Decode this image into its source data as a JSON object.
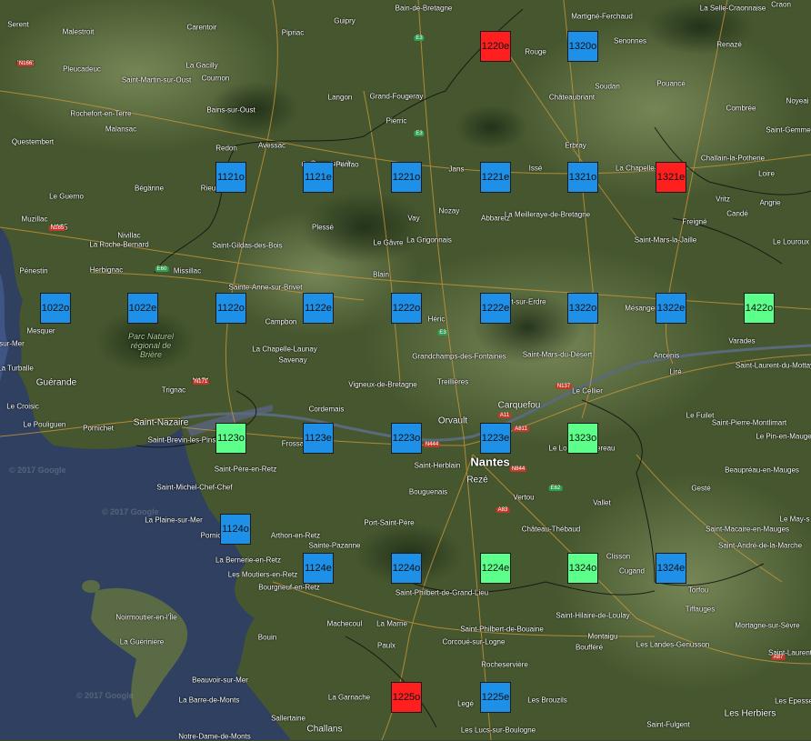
{
  "colors": {
    "blue": "#1e90e8",
    "red": "#ff1f1f",
    "green": "#5cff8a"
  },
  "markers": [
    {
      "label": "1220e",
      "color": "red"
    },
    {
      "label": "1320o",
      "color": "blue"
    },
    {
      "label": "1121o",
      "color": "blue"
    },
    {
      "label": "1121e",
      "color": "blue"
    },
    {
      "label": "1221o",
      "color": "blue"
    },
    {
      "label": "1221e",
      "color": "blue"
    },
    {
      "label": "1321o",
      "color": "blue"
    },
    {
      "label": "1321e",
      "color": "red"
    },
    {
      "label": "1022o",
      "color": "blue"
    },
    {
      "label": "1022e",
      "color": "blue"
    },
    {
      "label": "1122o",
      "color": "blue"
    },
    {
      "label": "1122e",
      "color": "blue"
    },
    {
      "label": "1222o",
      "color": "blue"
    },
    {
      "label": "1222e",
      "color": "blue"
    },
    {
      "label": "1322o",
      "color": "blue"
    },
    {
      "label": "1322e",
      "color": "blue"
    },
    {
      "label": "1422o",
      "color": "green"
    },
    {
      "label": "1123o",
      "color": "green"
    },
    {
      "label": "1123e",
      "color": "blue"
    },
    {
      "label": "1223o",
      "color": "blue"
    },
    {
      "label": "1223e",
      "color": "blue"
    },
    {
      "label": "1323o",
      "color": "green"
    },
    {
      "label": "1124o",
      "color": "blue"
    },
    {
      "label": "1124e",
      "color": "blue"
    },
    {
      "label": "1224o",
      "color": "blue"
    },
    {
      "label": "1224e",
      "color": "green"
    },
    {
      "label": "1324o",
      "color": "green"
    },
    {
      "label": "1324e",
      "color": "blue"
    },
    {
      "label": "1225o",
      "color": "red"
    },
    {
      "label": "1225e",
      "color": "blue"
    }
  ],
  "places": [
    "Serent",
    "Malestroit",
    "Carentoir",
    "Pipriac",
    "Guipry",
    "Bain-de-Bretagne",
    "Martigné-Ferchaud",
    "La Selle-Craonnaise",
    "Craon",
    "N166",
    "Pleucadeuc",
    "La Gacilly",
    "Saint-Martin-sur-Oust",
    "Cournon",
    "Rouge",
    "Senonnes",
    "Renazé",
    "Langon",
    "Grand-Fougeray",
    "Soudan",
    "Pouancé",
    "Noyeai",
    "Rochefort-en-Terre",
    "Malansac",
    "Bains-sur-Oust",
    "Pierric",
    "Châteaubriant",
    "Combrée",
    "Questembert",
    "Redon",
    "Avessac",
    "Conquereuil",
    "Erbray",
    "Saint-Gemme",
    "Challain-la-Potherie",
    "Loire",
    "Bégänne",
    "Rieux",
    "Guémené-Penfao",
    "Jans",
    "Issé",
    "La Chapelle-Glain",
    "Vritz",
    "Angrie",
    "Le Guerno",
    "Vay",
    "Nozay",
    "Abbaretz",
    "La Meilleraye-de-Bretagne",
    "Candé",
    "Muzillac",
    "N165",
    "Plessé",
    "Le Gâvre",
    "La Grigonnais",
    "Freigné",
    "Nivillac",
    "La Roche-Bernard",
    "Saint-Gildas-des-Bois",
    "Saint-Mars-la-Jaille",
    "Le Louroux",
    "Pénestin",
    "Missillac",
    "Sainte-Anne-sur-Brivet",
    "Blain",
    "Herbignac",
    "Campbon",
    "Héric",
    "Nort-sur-Erdre",
    "Mésanger",
    "Mesquer",
    "Varades",
    "sur-Mer",
    "Parc Naturel régional de Brière",
    "La Chapelle-Launay",
    "Savenay",
    "Grandchamps-des-Fontaines",
    "Saint-Mars-du-Désert",
    "Ancenis",
    "La Turballe",
    "Saint-Laurent-du-Mottay",
    "Guérande",
    "N171",
    "Liré",
    "Trignac",
    "Vigneux-de-Bretagne",
    "Treillières",
    "Le Cellier",
    "Le Croisic",
    "Cordemais",
    "Carquefou",
    "Le Fuilet",
    "Le Pouliguen",
    "Pornichet",
    "Saint-Nazaire",
    "Orvault",
    "Saint-Pierre-Montlimart",
    "Saint-Brevin-les-Pins",
    "Frossay",
    "Le Loroux-Bottereau",
    "Le Pin-en-Mauges",
    "Saint-Herblain",
    "Nantes",
    "Rezé",
    "Bouguenais",
    "Saint-Père-en-Retz",
    "Beaupréau-en-Mauges",
    "Saint-Michel-Chef-Chef",
    "Vertou",
    "Gesté",
    "Vallet",
    "La Plaine-sur-Mer",
    "Port-Saint-Père",
    "Château-Thébaud",
    "Le May-s",
    "Pornic",
    "Arthon-en-Retz",
    "Saint-Macaire-en-Mauges",
    "Sainte-Pazanne",
    "Saint-André-de-la-Marche",
    "La Bernerie-en-Retz",
    "Clisson",
    "Cugand",
    "Les Moutiers-en-Retz",
    "Bourgneuf-en-Retz",
    "Saint-Philbert-de-Grand-Lieu",
    "Torfou",
    "Tiffauges",
    "Machecoul",
    "La Marne",
    "Saint-Philbert-de-Bouaine",
    "Saint-Hilaire-de-Loulay",
    "Montaigu",
    "Mortagne-sur-Sèvre",
    "Noirmoutier-en-l'Île",
    "Bouin",
    "Paulx",
    "Corcoué-sur-Logne",
    "Boufféré",
    "Les Landes-Genusson",
    "Saint-Laurent",
    "La Guérinière",
    "Rocheservière",
    "Beauvoir-sur-Mer",
    "Legé",
    "Les Brouzils",
    "La Barre-de-Monts",
    "La Garnache",
    "Saint-Fulgent",
    "Les Herbiers",
    "Sallertaine",
    "Challans",
    "Les Lucs-sur-Boulogne",
    "Les Epesses",
    "Notre-Dame-de-Monts"
  ],
  "roads": [
    "E3",
    "E60",
    "E62",
    "A11",
    "A83",
    "A87",
    "N137",
    "N444",
    "N844",
    "N165",
    "N171",
    "N166",
    "A811",
    "E3",
    "E3"
  ],
  "watermarks": [
    "© 2017 Google",
    "© 2017 Google",
    "© 2017 Google"
  ]
}
